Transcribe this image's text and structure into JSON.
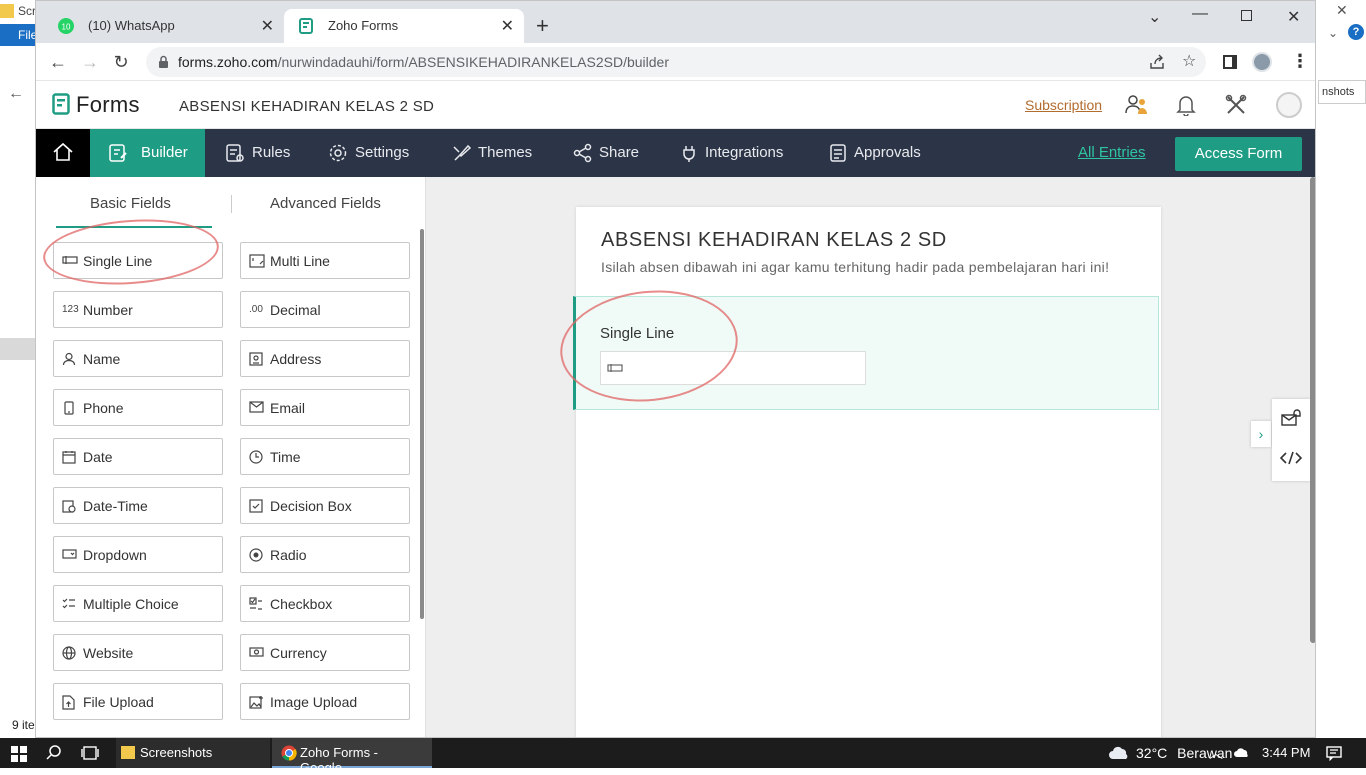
{
  "background": {
    "file_menu": "File",
    "screenshots_title": "Scr",
    "items_count": "9 ite",
    "screenshots_button": "nshots",
    "help": "?"
  },
  "browser": {
    "tabs": [
      {
        "label": "(10) WhatsApp",
        "favicon": "whatsapp-icon",
        "badge": "10"
      },
      {
        "label": "Zoho Forms",
        "favicon": "zoho-forms-icon"
      }
    ],
    "url_domain": "forms.zoho.com",
    "url_path": "/nurwindadauhi/form/ABSENSIKEHADIRANKELAS2SD/builder"
  },
  "header": {
    "logo": "Forms",
    "form_name": "ABSENSI KEHADIRAN KELAS 2 SD",
    "subscription": "Subscription"
  },
  "nav": {
    "items": [
      "Builder",
      "Rules",
      "Settings",
      "Themes",
      "Share",
      "Integrations",
      "Approvals"
    ],
    "all_entries": "All Entries",
    "access_form": "Access Form"
  },
  "panel": {
    "tab_basic": "Basic Fields",
    "tab_advanced": "Advanced Fields",
    "fields": [
      "Single Line",
      "Multi Line",
      "Number",
      "Decimal",
      "Name",
      "Address",
      "Phone",
      "Email",
      "Date",
      "Time",
      "Date-Time",
      "Decision Box",
      "Dropdown",
      "Radio",
      "Multiple Choice",
      "Checkbox",
      "Website",
      "Currency",
      "File Upload",
      "Image Upload"
    ],
    "icon_number": "123",
    "icon_decimal": ".00"
  },
  "form": {
    "title": "ABSENSI KEHADIRAN KELAS 2 SD",
    "description": "Isilah absen dibawah ini agar kamu terhitung hadir pada pembelajaran hari ini!",
    "field_label": "Single Line"
  },
  "taskbar": {
    "screenshots": "Screenshots",
    "chrome": "Zoho Forms - Google...",
    "temperature": "32°C",
    "weather": "Berawan",
    "time": "3:44 PM"
  },
  "colors": {
    "accent": "#1f9d84",
    "nav_bg": "#2c3547",
    "subscription": "#b26c2e",
    "annotation": "#e06464"
  }
}
